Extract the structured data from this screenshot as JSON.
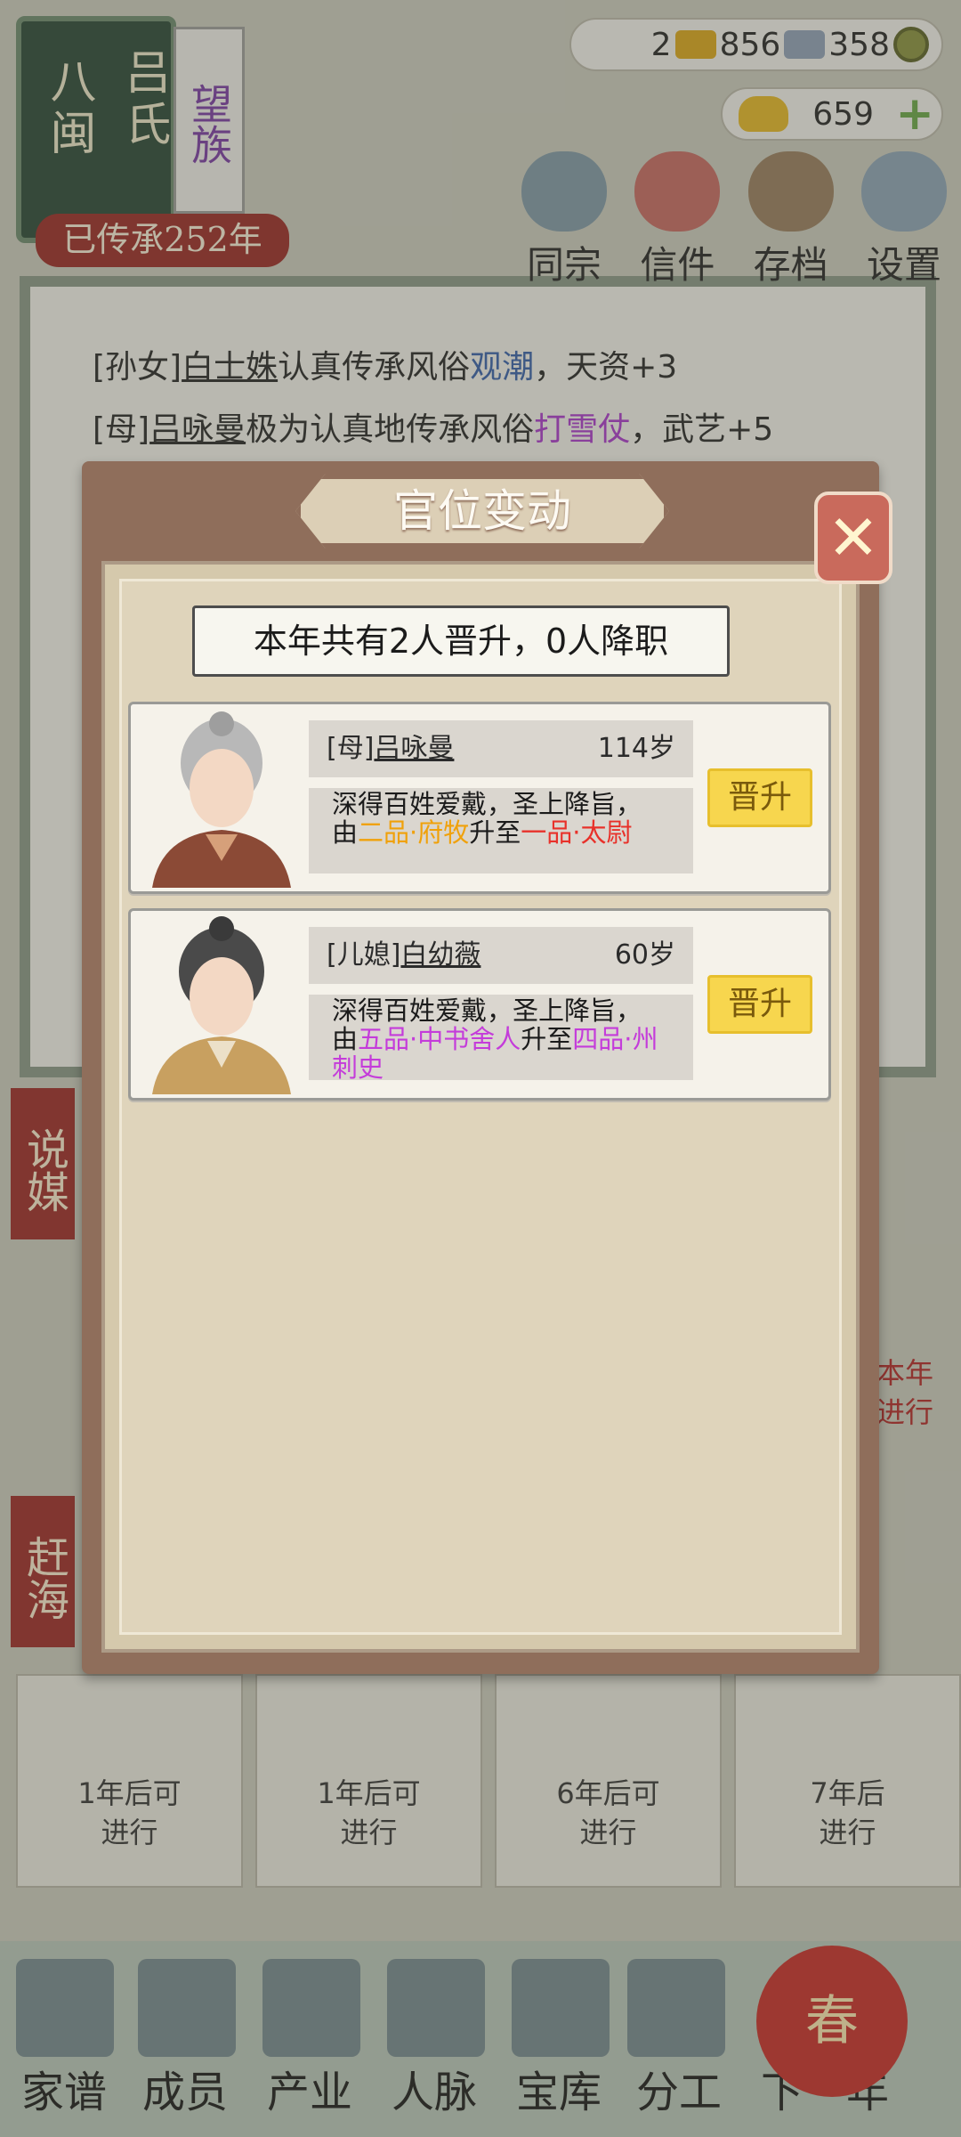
{
  "family": {
    "place": "八闽",
    "clan": "吕氏",
    "rank": "望族",
    "heritage": "已传承252年"
  },
  "currency": {
    "a": "2",
    "b": "856",
    "c": "358",
    "ingot": "659"
  },
  "top_menu": [
    "同宗",
    "信件",
    "存档",
    "设置"
  ],
  "log": {
    "line1_prefix": "[孙女]",
    "line1_name": "白士姝",
    "line1_mid": "认真传承风俗",
    "line1_custom": "观潮",
    "line1_tail": "，天资+3",
    "line2_prefix": "[母]",
    "line2_name": "吕咏曼",
    "line2_mid": "极为认真地传承风俗",
    "line2_custom": "打雪仗",
    "line2_tail": "，武艺+5"
  },
  "side_buttons": [
    "说媒",
    "赶海"
  ],
  "right_card": "本年\n进行",
  "activity_cards": [
    "1年后可\n进行",
    "1年后可\n进行",
    "6年后可\n进行",
    "7年后\n进行"
  ],
  "bottom_nav": [
    "家谱",
    "成员",
    "产业",
    "人脉",
    "宝库",
    "分工",
    "下一年"
  ],
  "next_year_icon": "春",
  "modal": {
    "title": "官位变动",
    "close": "✕",
    "summary": "本年共有2人晋升，0人降职",
    "people": [
      {
        "relation": "[母]",
        "name": "吕咏曼",
        "age": "114岁",
        "text_a": "深得百姓爱戴，圣上降旨，",
        "text_b": "由",
        "from": "二品·府牧",
        "mid": "升至",
        "to": "一品·太尉",
        "button": "晋升"
      },
      {
        "relation": "[儿媳]",
        "name": "白幼薇",
        "age": "60岁",
        "text_a": "深得百姓爱戴，圣上降旨，",
        "text_b": "由",
        "from": "五品·中书舍人",
        "mid": "升至",
        "to": "四品·州刺史",
        "button": "晋升"
      }
    ]
  },
  "colors": {
    "from_1": "#f0a10a",
    "to_1": "#e8312a",
    "from_2": "#c43cda",
    "to_2": "#c43cda"
  }
}
